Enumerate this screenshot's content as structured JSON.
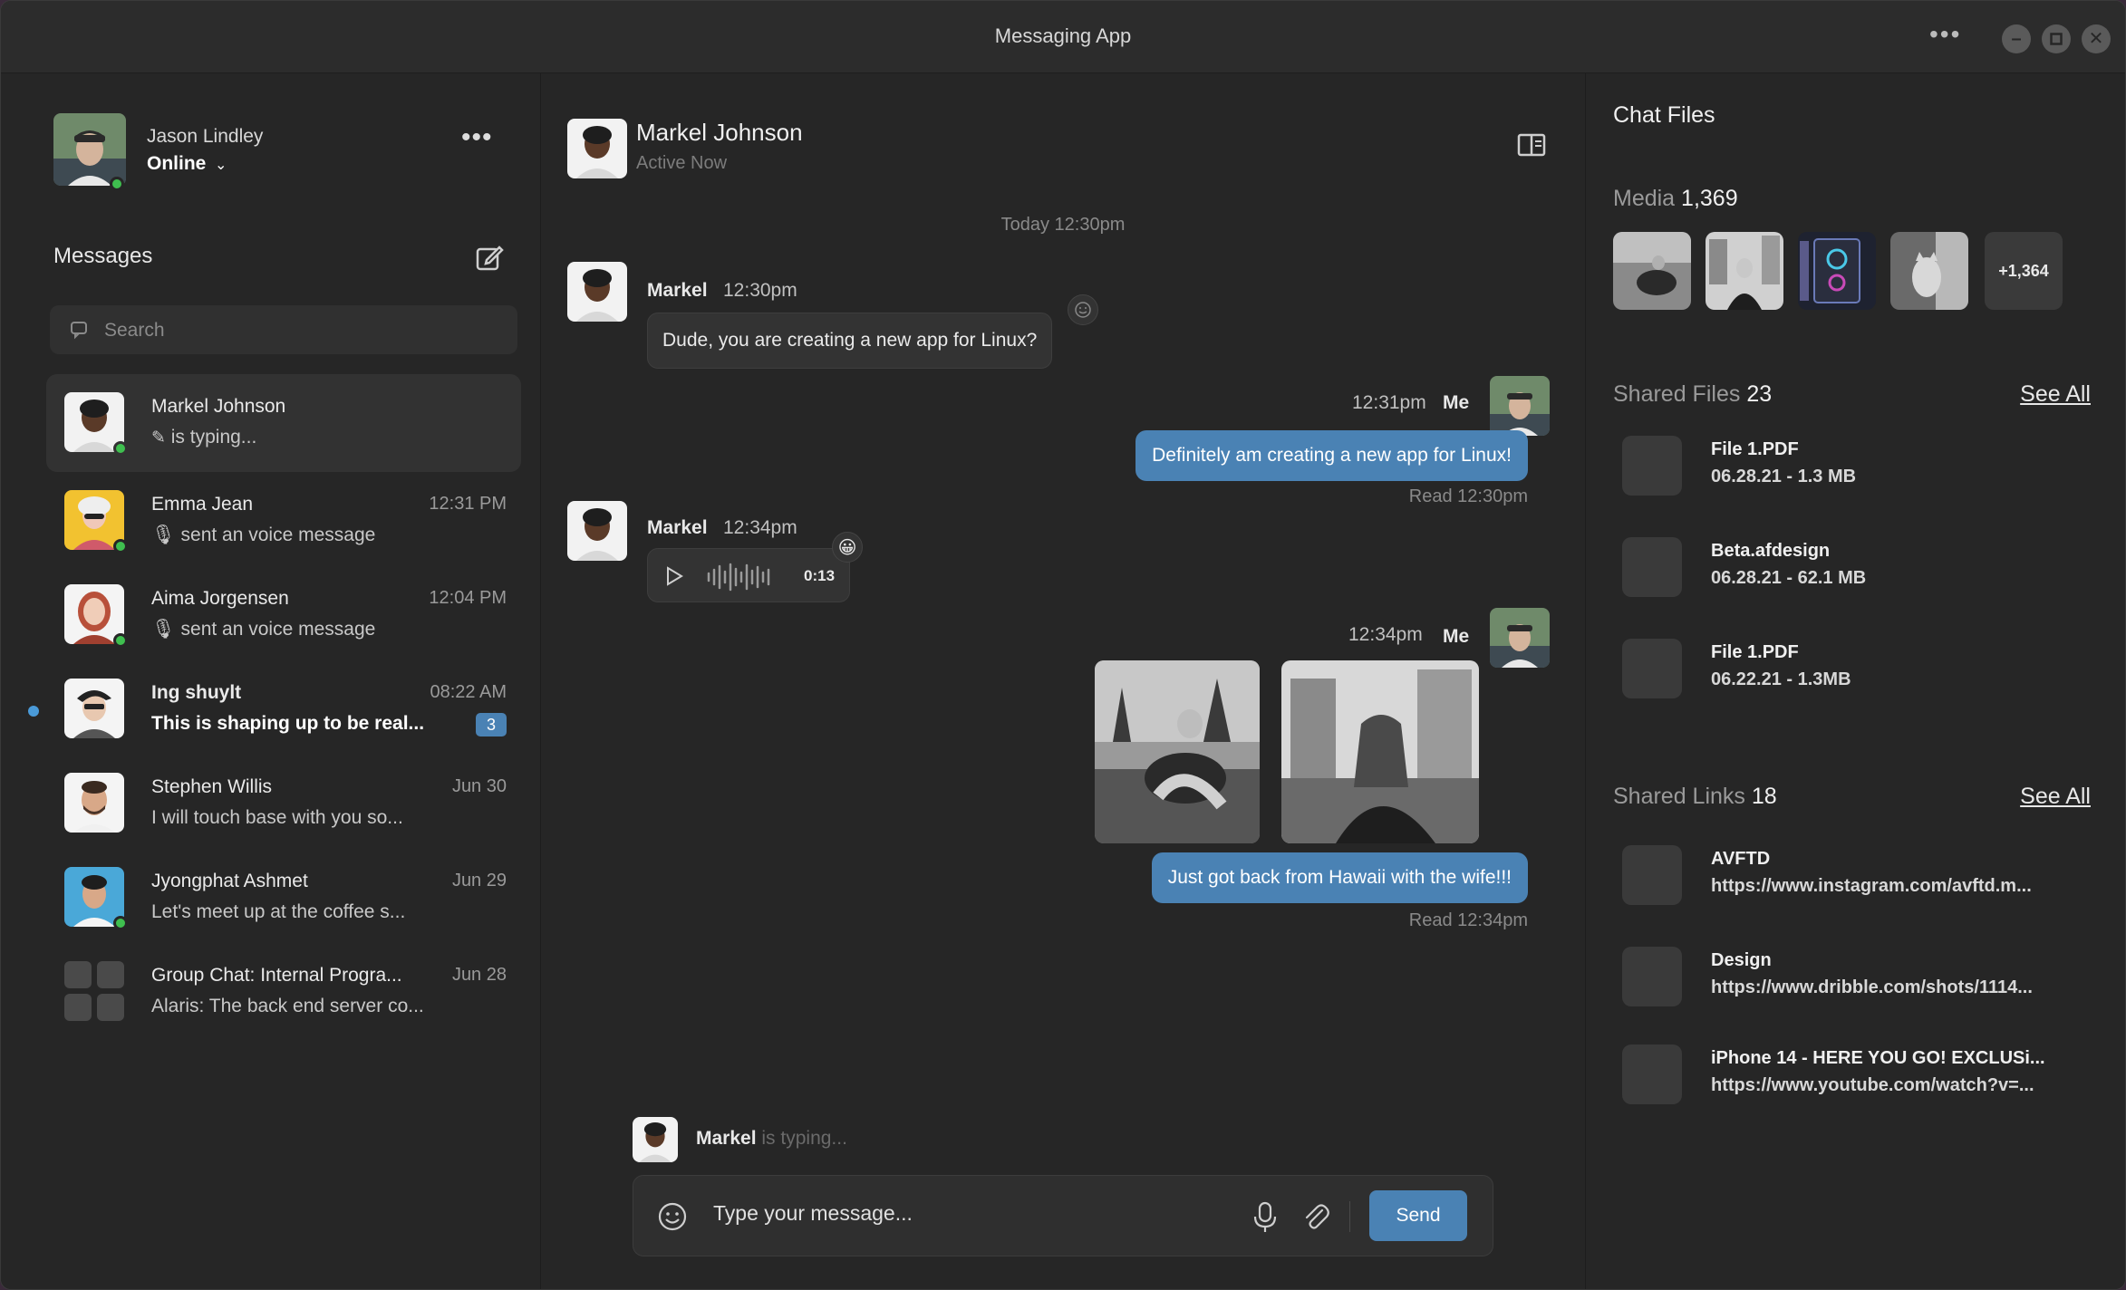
{
  "window": {
    "title": "Messaging App"
  },
  "user": {
    "name": "Jason Lindley",
    "status": "Online"
  },
  "sidebar": {
    "title": "Messages",
    "search_placeholder": "Search",
    "conversations": [
      {
        "name": "Markel Johnson",
        "time": "",
        "preview": "is typing...",
        "online": true,
        "active": true
      },
      {
        "name": "Emma Jean",
        "time": "12:31 PM",
        "preview": "sent an voice message",
        "online": true
      },
      {
        "name": "Aima Jorgensen",
        "time": "12:04 PM",
        "preview": "sent an voice message",
        "online": true
      },
      {
        "name": "Ing shuylt",
        "time": "08:22 AM",
        "preview": "This is shaping up to be real...",
        "badge": "3",
        "unread": true
      },
      {
        "name": "Stephen Willis",
        "time": "Jun 30",
        "preview": "I will touch base with you so..."
      },
      {
        "name": "Jyongphat Ashmet",
        "time": "Jun 29",
        "preview": "Let's meet up at the coffee s...",
        "online": true
      },
      {
        "name": "Group Chat: Internal Progra...",
        "time": "Jun 28",
        "preview": "Alaris: The back end server co..."
      }
    ]
  },
  "chat": {
    "contact_name": "Markel Johnson",
    "contact_status": "Active Now",
    "date_separator": "Today 12:30pm",
    "messages": [
      {
        "sender": "Markel",
        "time": "12:30pm",
        "text": "Dude, you are creating a new app for Linux?"
      },
      {
        "sender": "Me",
        "time": "12:31pm",
        "text": "Definitely am creating a new app for Linux!",
        "read": "Read 12:30pm"
      },
      {
        "sender": "Markel",
        "time": "12:34pm",
        "voice_duration": "0:13",
        "reaction": "😀"
      },
      {
        "sender": "Me",
        "time": "12:34pm",
        "text": "Just got back from Hawaii with the wife!!!",
        "read": "Read 12:34pm"
      }
    ],
    "typing_name": "Markel",
    "typing_text": "is typing...",
    "input_placeholder": "Type your message...",
    "send_label": "Send"
  },
  "files_panel": {
    "title": "Chat Files",
    "media_label": "Media",
    "media_count": "1,369",
    "media_more": "+1,364",
    "shared_files_label": "Shared Files",
    "shared_files_count": "23",
    "see_all": "See All",
    "files": [
      {
        "name": "File 1.PDF",
        "meta": "06.28.21 - 1.3 MB"
      },
      {
        "name": "Beta.afdesign",
        "meta": "06.28.21 - 62.1 MB"
      },
      {
        "name": "File 1.PDF",
        "meta": "06.22.21 - 1.3MB"
      }
    ],
    "shared_links_label": "Shared Links",
    "shared_links_count": "18",
    "links": [
      {
        "name": "AVFTD",
        "url": "https://www.instagram.com/avftd.m..."
      },
      {
        "name": "Design",
        "url": "https://www.dribble.com/shots/1114..."
      },
      {
        "name": "iPhone 14 - HERE YOU GO! EXCLUSi...",
        "url": "https://www.youtube.com/watch?v=..."
      }
    ]
  },
  "colors": {
    "accent": "#4a82b4",
    "online": "#3fbf4f",
    "background": "#262626"
  }
}
